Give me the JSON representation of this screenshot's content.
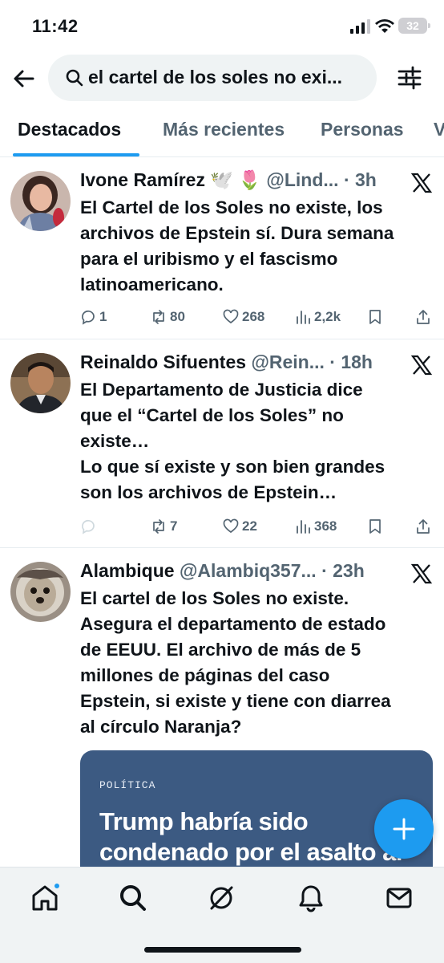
{
  "status_bar": {
    "time": "11:42",
    "battery": "32"
  },
  "search": {
    "query": "el cartel de los soles no exi..."
  },
  "tabs": [
    {
      "label": "Destacados",
      "active": true
    },
    {
      "label": "Más recientes",
      "active": false
    },
    {
      "label": "Personas",
      "active": false
    },
    {
      "label": "V",
      "active": false
    }
  ],
  "tweets": [
    {
      "name": "Ivone Ramírez 🕊️ 🌷",
      "handle": "@Lind...",
      "time": "· 3h",
      "lines": [
        "El Cartel de los Soles no existe, los",
        "archivos de Epstein sí. Dura semana",
        "para el uribismo y el fascismo",
        "latinoamericano."
      ],
      "replies": "1",
      "reposts": "80",
      "likes": "268",
      "views": "2,2k"
    },
    {
      "name": "Reinaldo Sifuentes",
      "handle": "@Rein...",
      "time": "· 18h",
      "lines": [
        "El Departamento de Justicia dice",
        "que el “Cartel de los Soles” no",
        "existe…",
        "Lo que sí existe y son bien grandes",
        "son los archivos de Epstein…"
      ],
      "replies": "",
      "reposts": "7",
      "likes": "22",
      "views": "368"
    },
    {
      "name": "Alambique",
      "handle": "@Alambiq357...",
      "time": "· 23h",
      "lines": [
        "El cartel de los Soles no existe.",
        "Asegura el departamento de estado",
        "de EEUU. El archivo de más de 5",
        "millones de páginas del caso",
        "Epstein, si existe y tiene con diarrea",
        "al círculo Naranja?"
      ],
      "card": {
        "category": "POLÍTICA",
        "title": "Trump habría sido condenado por el asalto al"
      }
    }
  ],
  "colors": {
    "accent": "#1d9bf0",
    "text": "#0f1419",
    "muted": "#536471",
    "card_bg": "#3c5a82"
  },
  "icons": [
    "back-arrow-icon",
    "search-icon",
    "filter-icon",
    "x-logo-icon",
    "reply-icon",
    "repost-icon",
    "like-icon",
    "views-icon",
    "bookmark-icon",
    "share-icon",
    "compose-icon",
    "home-icon",
    "explore-icon",
    "grok-icon",
    "notifications-icon",
    "messages-icon"
  ]
}
